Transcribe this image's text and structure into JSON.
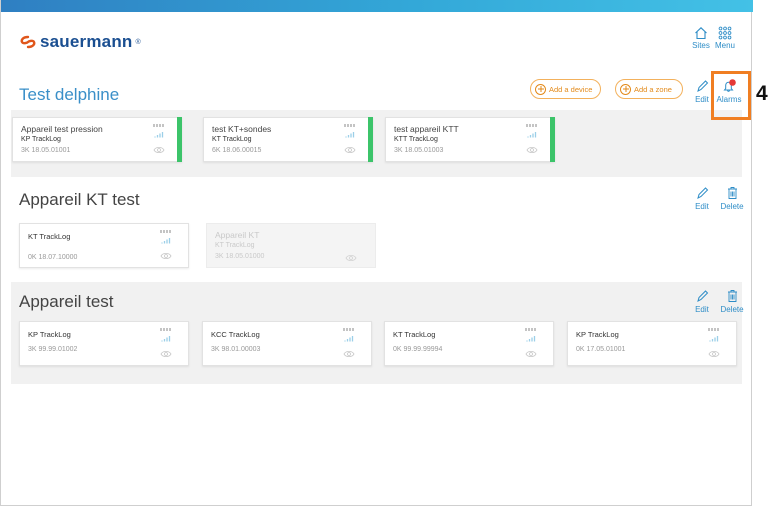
{
  "brand": {
    "name": "sauermann",
    "reg": "®"
  },
  "nav": {
    "sites_label": "Sites",
    "menu_label": "Menu"
  },
  "sections": [
    {
      "title": "Test delphine",
      "buttons": {
        "add_device": "Add a device",
        "add_zone": "Add a zone",
        "edit": "Edit",
        "alarms": "Alarms"
      },
      "cards": [
        {
          "name": "Appareil test pression",
          "model": "KP TrackLog",
          "serial": "3K 18.05.01001",
          "status": "active"
        },
        {
          "name": "test KT+sondes",
          "model": "KT TrackLog",
          "serial": "6K 18.06.00015",
          "status": "active"
        },
        {
          "name": "test appareil KTT",
          "model": "KTT TrackLog",
          "serial": "3K 18.05.01003",
          "status": "active"
        }
      ]
    },
    {
      "title": "Appareil KT test",
      "buttons": {
        "edit": "Edit",
        "delete": "Delete"
      },
      "cards": [
        {
          "name": "KT TrackLog",
          "serial": "0K 18.07.10000",
          "status": "normal"
        },
        {
          "name": "Appareil KT",
          "model": "KT TrackLog",
          "serial": "3K 18.05.01000",
          "status": "disabled"
        }
      ]
    },
    {
      "title": "Appareil test",
      "buttons": {
        "edit": "Edit",
        "delete": "Delete"
      },
      "cards": [
        {
          "name": "KP TrackLog",
          "serial": "3K 99.99.01002",
          "status": "normal"
        },
        {
          "name": "KCC TrackLog",
          "serial": "3K 98.01.00003",
          "status": "normal"
        },
        {
          "name": "KT TrackLog",
          "serial": "0K 99.99.99994",
          "status": "normal"
        },
        {
          "name": "KP TrackLog",
          "serial": "0K 17.05.01001",
          "status": "normal"
        }
      ]
    }
  ],
  "annotation": {
    "number": "4",
    "color": "#f07e22"
  },
  "colors": {
    "accent": "#2e8dc7",
    "orange": "#e38a1a",
    "status_green": "#3cc46a",
    "alarm_red": "#e53935"
  }
}
